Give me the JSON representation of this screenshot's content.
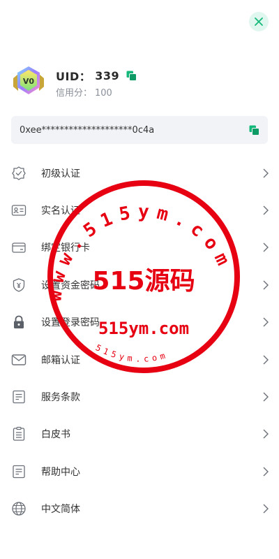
{
  "header": {
    "close_icon": "close-icon"
  },
  "profile": {
    "level_badge": "V0",
    "uid_label": "UID：",
    "uid_value": "339",
    "credit_label": "信用分：",
    "credit_value": "100"
  },
  "wallet": {
    "address": "0xee********************0c4a"
  },
  "menu": {
    "items": [
      {
        "label": "初级认证",
        "icon": "verified-badge-icon"
      },
      {
        "label": "实名认证",
        "icon": "id-card-icon"
      },
      {
        "label": "绑定银行卡",
        "icon": "bank-card-icon"
      },
      {
        "label": "设置资金密码",
        "icon": "fund-shield-icon"
      },
      {
        "label": "设置登录密码",
        "icon": "lock-icon"
      },
      {
        "label": "邮箱认证",
        "icon": "mail-icon"
      },
      {
        "label": "服务条款",
        "icon": "document-icon"
      },
      {
        "label": "白皮书",
        "icon": "clipboard-icon"
      },
      {
        "label": "帮助中心",
        "icon": "help-document-icon"
      },
      {
        "label": "中文简体",
        "icon": "globe-icon"
      }
    ]
  },
  "watermark": {
    "ring_text": "www.515ym.com",
    "center_title": "515源码",
    "center_url": "515ym.com",
    "bottom_text": "515ym.com",
    "color": "#e60012"
  },
  "colors": {
    "accent": "#14b87a",
    "close_bg": "#dff7ee",
    "field_bg": "#f2f3f7"
  }
}
